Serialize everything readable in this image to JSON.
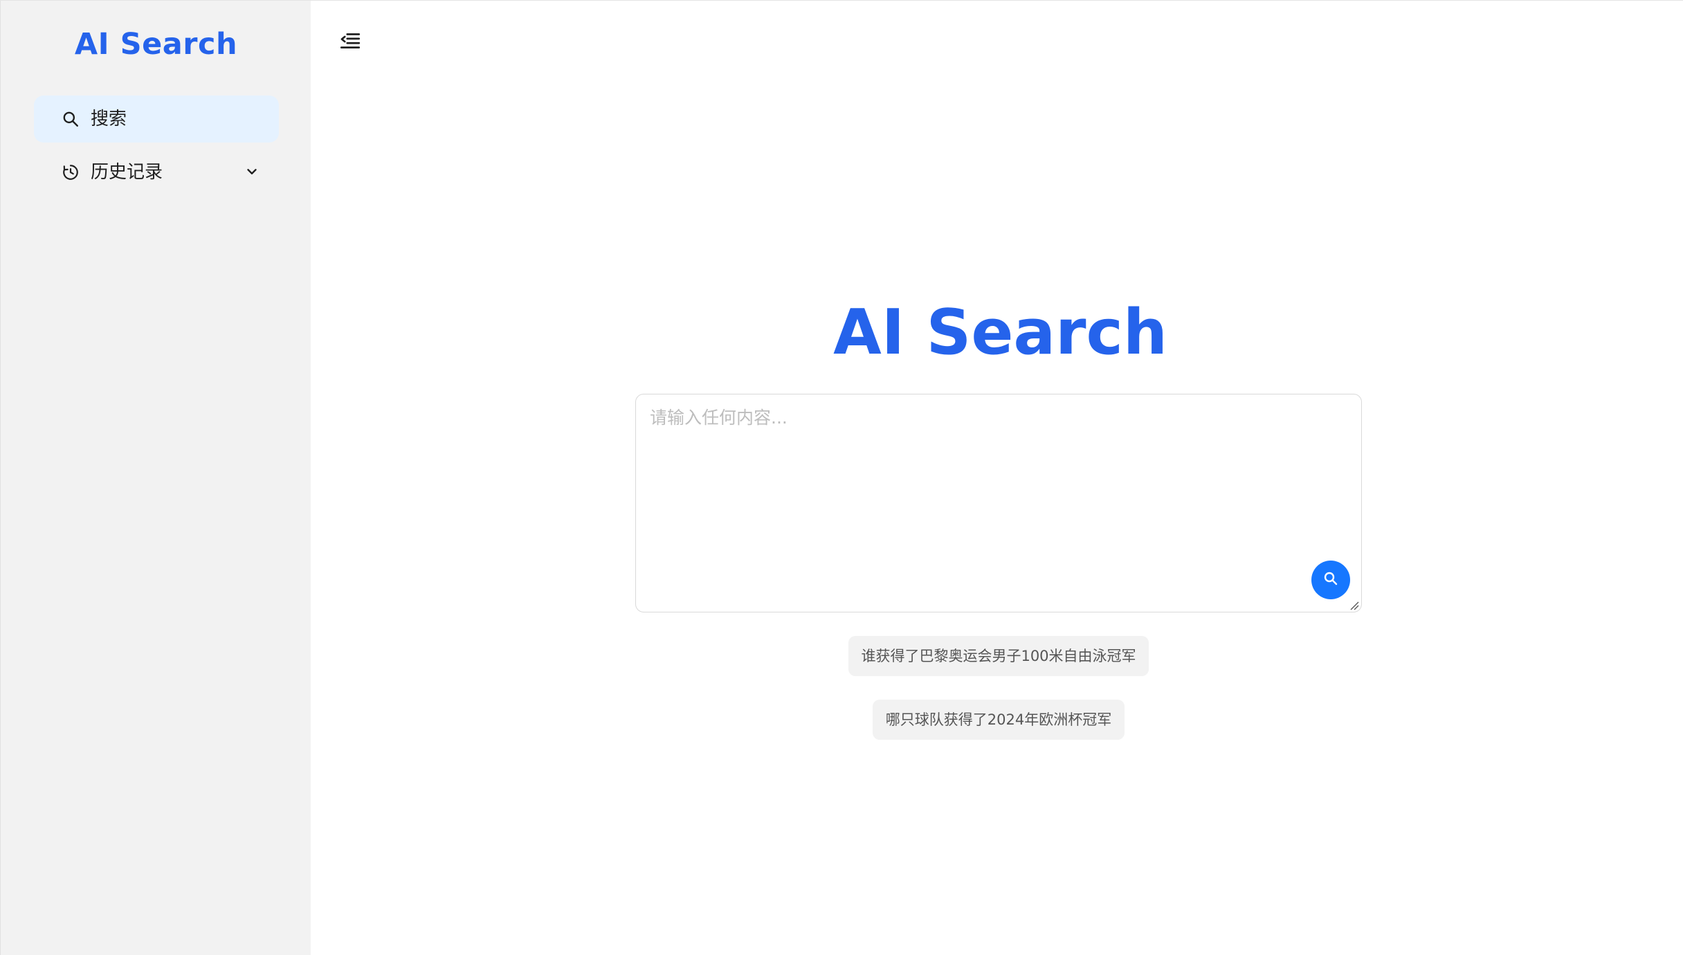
{
  "sidebar": {
    "brand": "AI Search",
    "items": [
      {
        "label": "搜索",
        "icon": "search-icon",
        "active": true
      },
      {
        "label": "历史记录",
        "icon": "history-icon",
        "expandable": true,
        "expand_icon": "chevron-down-icon"
      }
    ]
  },
  "header": {
    "collapse_icon": "menu-fold-icon"
  },
  "main": {
    "title": "AI Search",
    "search": {
      "placeholder": "请输入任何内容...",
      "value": "",
      "submit_icon": "search-icon"
    },
    "suggestions": [
      "谁获得了巴黎奥运会男子100米自由泳冠军",
      "哪只球队获得了2024年欧洲杯冠军"
    ]
  },
  "colors": {
    "brand": "#2563eb",
    "accent": "#1677ff",
    "sidebar_bg": "#f2f2f2",
    "active_item_bg": "#e5f2ff",
    "chip_bg": "#f2f2f2"
  }
}
